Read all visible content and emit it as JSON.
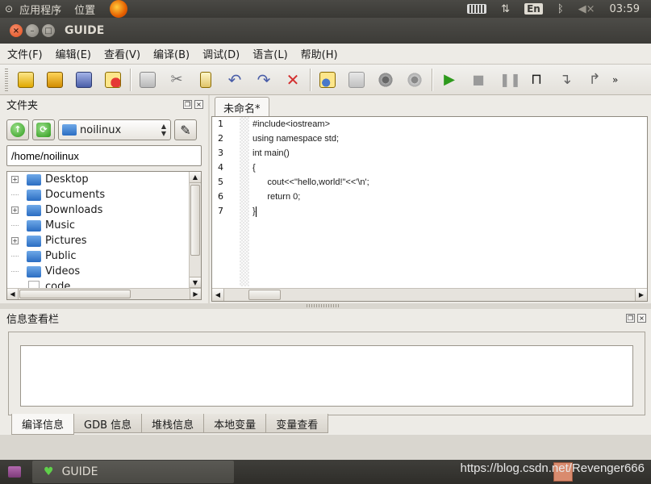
{
  "top_bar": {
    "menus": [
      "应用程序",
      "位置"
    ],
    "lang": "En",
    "clock": "03:59"
  },
  "window": {
    "title": "GUIDE"
  },
  "menubar": [
    "文件(F)",
    "编辑(E)",
    "查看(V)",
    "编译(B)",
    "调试(D)",
    "语言(L)",
    "帮助(H)"
  ],
  "toolbar": {
    "more": "»"
  },
  "file_panel": {
    "title": "文件夹",
    "folder_combo": "noilinux",
    "path": "/home/noilinux",
    "tree": [
      {
        "name": "Desktop",
        "expandable": true
      },
      {
        "name": "Documents",
        "expandable": false
      },
      {
        "name": "Downloads",
        "expandable": true
      },
      {
        "name": "Music",
        "expandable": false
      },
      {
        "name": "Pictures",
        "expandable": true
      },
      {
        "name": "Public",
        "expandable": false
      },
      {
        "name": "Videos",
        "expandable": false
      },
      {
        "name": "code",
        "expandable": false
      }
    ]
  },
  "editor": {
    "tab_label": "未命名*",
    "lines": [
      {
        "num": "1",
        "text": "#include<iostream>"
      },
      {
        "num": "2",
        "text": "using namespace std;"
      },
      {
        "num": "3",
        "text": "int main()"
      },
      {
        "num": "4",
        "text": "{"
      },
      {
        "num": "5",
        "text": "      cout<<\"hello,world!\"<<'\\n';"
      },
      {
        "num": "6",
        "text": "      return 0;"
      },
      {
        "num": "7",
        "text": "}"
      }
    ]
  },
  "info_panel": {
    "title": "信息查看栏",
    "tabs": [
      "编译信息",
      "GDB 信息",
      "堆栈信息",
      "本地变量",
      "变量查看"
    ]
  },
  "taskbar": {
    "app": "GUIDE",
    "watermark": "https://blog.csdn.net/Revenger666"
  }
}
